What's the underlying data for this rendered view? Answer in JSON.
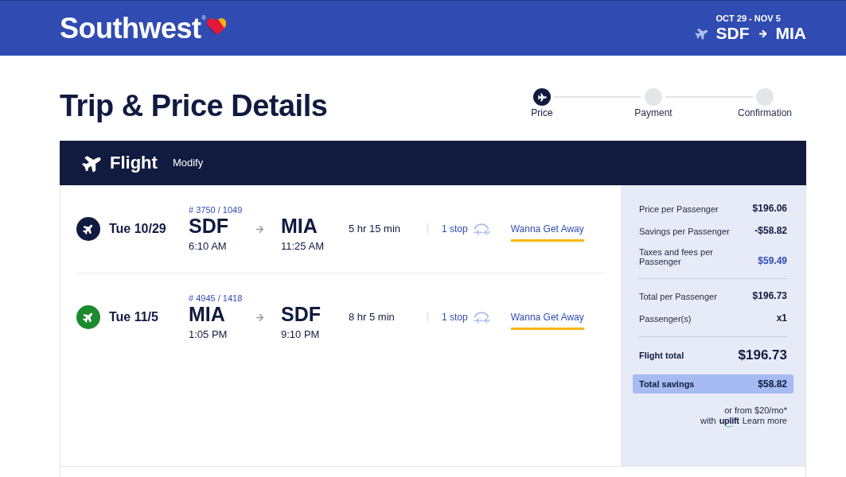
{
  "header": {
    "logo": "Southwest",
    "registered_mark": "®",
    "trip_dates": "OCT 29 - NOV 5",
    "origin": "SDF",
    "destination": "MIA"
  },
  "page_title": "Trip & Price Details",
  "steps": [
    {
      "label": "Price",
      "selected": true
    },
    {
      "label": "Payment",
      "selected": false
    },
    {
      "label": "Confirmation",
      "selected": false
    }
  ],
  "flight_section": {
    "title": "Flight",
    "modify_link": "Modify"
  },
  "flights": [
    {
      "date": "Tue 10/29",
      "color": "#111b40",
      "flight_numbers": "# 3750 / 1049",
      "origin": "SDF",
      "depart_time": "6:10 AM",
      "destination": "MIA",
      "arrive_time": "11:25 AM",
      "duration": "5 hr 15 min",
      "stops": "1 stop",
      "fare": "Wanna Get Away"
    },
    {
      "date": "Tue 11/5",
      "color": "#1e8a2f",
      "flight_numbers": "# 4945 / 1418",
      "origin": "MIA",
      "depart_time": "1:05 PM",
      "destination": "SDF",
      "arrive_time": "9:10 PM",
      "duration": "8 hr 5 min",
      "stops": "1 stop",
      "fare": "Wanna Get Away"
    }
  ],
  "summary": {
    "groups": [
      {
        "rows": [
          {
            "label": "Price per Passenger",
            "value": "$196.06",
            "kind": "amount"
          },
          {
            "label": "Savings per Passenger",
            "value": "-$58.82",
            "kind": "amount"
          },
          {
            "label": "Taxes and fees per Passenger",
            "value": "$59.49",
            "kind": "link"
          }
        ]
      },
      {
        "rows": [
          {
            "label": "Total per Passenger",
            "value": "$196.73",
            "kind": "amount"
          },
          {
            "label": "Passenger(s)",
            "value": "x1",
            "kind": "amount"
          }
        ]
      }
    ],
    "total": {
      "label": "Flight total",
      "value": "$196.73"
    },
    "savings": {
      "label": "Total savings",
      "value": "$58.82"
    },
    "financing": {
      "text": "or from $20/mo*",
      "prefix": "with",
      "provider": "uplift",
      "link": "Learn more"
    }
  }
}
